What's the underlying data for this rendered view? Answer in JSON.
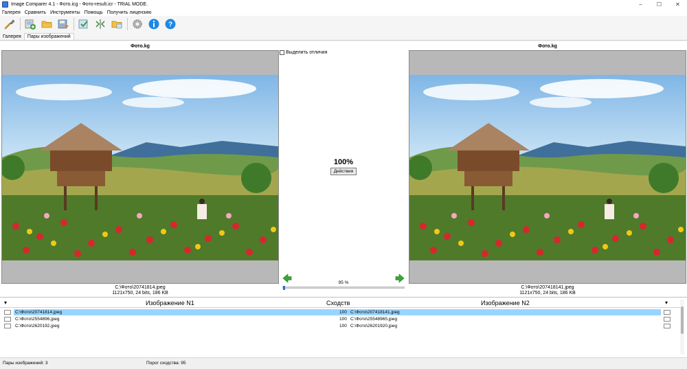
{
  "window": {
    "title": "Image Comparer 4.1 - Фото.icg - Фото-result.icr - TRIAL MODE.",
    "minimize": "–",
    "maximize": "☐",
    "close": "✕"
  },
  "menu": [
    "Галерея",
    "Сравнить",
    "Инструменты",
    "Помощь",
    "Получить лицензию"
  ],
  "toolbar": {
    "icons": [
      "brush-icon",
      "add-gallery-icon",
      "open-folder-icon",
      "save-icon",
      "compare-icon",
      "split-compare-icon",
      "folder-compare-icon",
      "settings-icon",
      "info-icon",
      "help-icon"
    ],
    "colors": {
      "info": "#1e88e5",
      "help": "#1e88e5",
      "accent": "#3f9a3f"
    }
  },
  "tabs": [
    "Галерея",
    "Пары изображений"
  ],
  "left_panel": {
    "title": "Фото.kg",
    "path": "C:\\Фото\\20741814.jpeg",
    "info": "1121x750, 24 bits, 186 KB"
  },
  "right_panel": {
    "title": "Фото.kg",
    "path": "C:\\Фото\\207418141.jpeg",
    "info": "1121x750, 24 bits, 186 KB"
  },
  "center": {
    "highlight_label": "Выделить отличия",
    "similarity": "100%",
    "actions_label": "Действия",
    "zoom_label": "95 %",
    "zoom_fraction": 0.0
  },
  "table": {
    "headers": {
      "image1": "Изображение N1",
      "similarity": "Сходств",
      "image2": "Изображение N2"
    },
    "rows": [
      {
        "left": "C:\\Фото\\20741814.jpeg",
        "score": "100",
        "right": "C:\\Фото\\207418141.jpeg",
        "selected": true
      },
      {
        "left": "C:\\Фото\\2554896.jpeg",
        "score": "100",
        "right": "C:\\Фото\\25548965.jpeg",
        "selected": false
      },
      {
        "left": "C:\\Фото\\2620192.jpeg",
        "score": "100",
        "right": "C:\\Фото\\26201920.jpeg",
        "selected": false
      }
    ]
  },
  "status": {
    "pairs": "Пары изображений: 3",
    "threshold": "Порог сходства: 95"
  }
}
